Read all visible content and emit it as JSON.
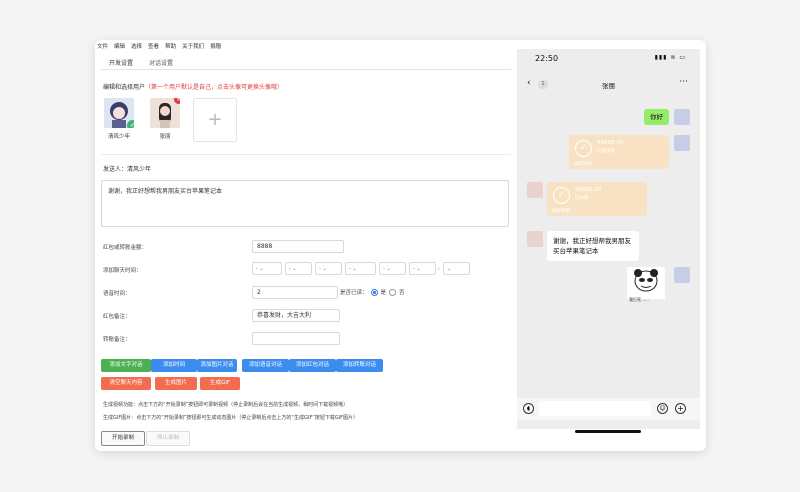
{
  "menu": [
    "文件",
    "编辑",
    "选择",
    "查看",
    "帮助",
    "关于我们",
    "捐赠"
  ],
  "tabs": [
    "开发设置",
    "对话设置"
  ],
  "user_section": {
    "label": "编辑和选择用户",
    "hint": "（第一个用户默认是自己，点击头像可更换头像哦）"
  },
  "users": [
    {
      "name": "清风少年",
      "selected": true
    },
    {
      "name": "张丽",
      "selected": false
    }
  ],
  "sender": {
    "label": "发送人：",
    "name": "清风少年"
  },
  "message_text": "谢谢，我正好想帮我男朋友买台苹果笔记本",
  "form": {
    "amount_label": "红包或转账金额：",
    "amount_value": "8888",
    "time_label": "添加聊天时间：",
    "time_selects": [
      "-",
      "-",
      "-",
      "-",
      "-",
      "-"
    ],
    "time_sep": ":",
    "duration_label": "语音时间：",
    "duration_value": "2",
    "read_label": "是否已读：",
    "read_yes": "是",
    "read_no": "否",
    "redpacket_label": "红包备注：",
    "redpacket_value": "恭喜发财，大吉大利",
    "transfer_label": "转账备注："
  },
  "buttons_row1": [
    "添加文字对话",
    "添加时间",
    "添加图片对话",
    "添加语音对话",
    "添加红包对话",
    "添加转账对话"
  ],
  "buttons_row2": [
    "清空聊天内容",
    "生成图片",
    "生成GIF"
  ],
  "help": {
    "line1": "生成视频功能：点击下方的“开始录制”按钮即可录制视频（停止录制后会在当前生成视频，稍时间下载视频哦）",
    "line2": "生成GIF图片：点击下方的“开始录制”按钮即可生成动态图片（停止录制后点击上方的“生成GIF”按钮下载GIF图片）"
  },
  "record": {
    "start": "开始录制",
    "stop": "停止录制"
  },
  "phone": {
    "time": "22:50",
    "status_icons": "▮▮▮ ≋ ▭",
    "unread": "1",
    "chat_title": "张丽",
    "more": "···",
    "my_message": "你好",
    "transfer1": {
      "amount": "¥8888.00",
      "status": "已被接收",
      "footer": "微信转账"
    },
    "transfer2": {
      "amount": "¥8888.00",
      "status": "已收款",
      "footer": "微信转账"
    },
    "other_message": "谢谢，我正好想帮我男朋友买台苹果笔记本",
    "sticker_caption": "我打死……"
  },
  "colors": {
    "accent_green": "#4caf50",
    "accent_blue": "#3c8cf0",
    "accent_red": "#f26c4f",
    "wechat_green": "#95ec69",
    "transfer": "#f8e2c3"
  }
}
